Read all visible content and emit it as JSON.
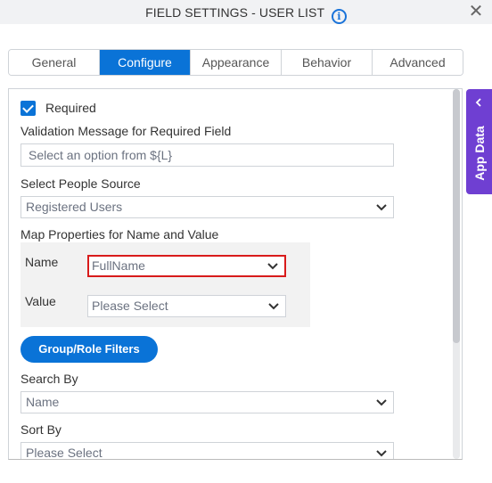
{
  "dialog": {
    "title": "FIELD SETTINGS - USER LIST",
    "info_icon": "info-icon",
    "close_icon": "close-icon",
    "close_glyph": "✕",
    "info_glyph": "i"
  },
  "tabs": [
    {
      "label": "General",
      "active": false
    },
    {
      "label": "Configure",
      "active": true
    },
    {
      "label": "Appearance",
      "active": false
    },
    {
      "label": "Behavior",
      "active": false
    },
    {
      "label": "Advanced",
      "active": false
    }
  ],
  "form": {
    "required": {
      "label": "Required",
      "checked": true
    },
    "validation": {
      "label": "Validation Message for Required Field",
      "placeholder": "Select an option from ${L}",
      "value": ""
    },
    "people_source": {
      "label": "Select People Source",
      "value": "Registered Users"
    },
    "map_properties": {
      "label": "Map Properties for Name and Value",
      "name": {
        "label": "Name",
        "value": "FullName"
      },
      "value": {
        "label": "Value",
        "value": "Please Select"
      }
    },
    "group_role_button": "Group/Role Filters",
    "search_by": {
      "label": "Search By",
      "value": "Name"
    },
    "sort_by": {
      "label": "Sort By",
      "value": "Please Select"
    }
  },
  "side_panel": {
    "label": "App Data",
    "icon": "chevron-left-icon"
  },
  "colors": {
    "accent": "#0a73d7",
    "side_panel": "#6f3fd2",
    "highlight": "#d81b1b"
  }
}
